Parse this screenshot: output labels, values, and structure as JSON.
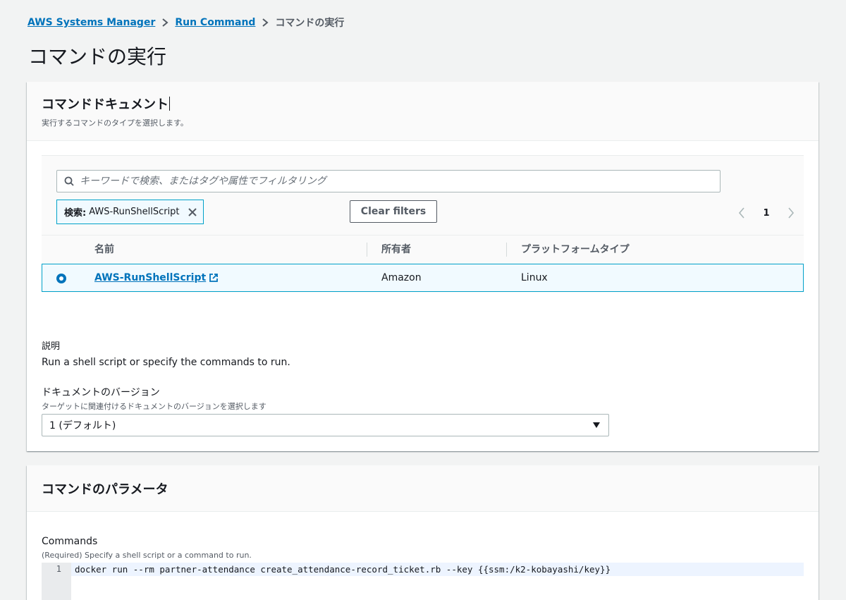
{
  "breadcrumb": {
    "items": [
      "AWS Systems Manager",
      "Run Command"
    ],
    "current": "コマンドの実行"
  },
  "page_title": "コマンドの実行",
  "document_panel": {
    "title": "コマンドドキュメント",
    "description": "実行するコマンドのタイプを選択します。",
    "search_placeholder": "キーワードで検索、またはタグや属性でフィルタリング",
    "filter_token": {
      "label": "検索:",
      "value": "AWS-RunShellScript"
    },
    "clear_filters_label": "Clear filters",
    "pagination": {
      "current_page": "1"
    },
    "columns": [
      "名前",
      "所有者",
      "プラットフォームタイプ"
    ],
    "rows": [
      {
        "name": "AWS-RunShellScript",
        "owner": "Amazon",
        "platform": "Linux",
        "selected": true
      }
    ],
    "description_label": "説明",
    "description_text": "Run a shell script or specify the commands to run.",
    "version_label": "ドキュメントのバージョン",
    "version_hint": "ターゲットに関連付けるドキュメントのバージョンを選択します",
    "version_value": "1 (デフォルト)"
  },
  "params_panel": {
    "title": "コマンドのパラメータ",
    "commands_label": "Commands",
    "commands_hint": "(Required) Specify a shell script or a command to run.",
    "editor_lines": [
      {
        "number": "1",
        "text": "docker run --rm partner-attendance create_attendance-record_ticket.rb --key {{ssm:/k2-kobayashi/key}}"
      }
    ]
  },
  "colors": {
    "link": "#0073bb",
    "selected_border": "#00a1c9",
    "selected_bg": "#f1faff",
    "background": "#f2f3f3"
  },
  "icons": [
    "chevron-right-icon",
    "search-icon",
    "close-icon",
    "chevron-left-icon",
    "external-link-icon",
    "caret-down-icon"
  ]
}
